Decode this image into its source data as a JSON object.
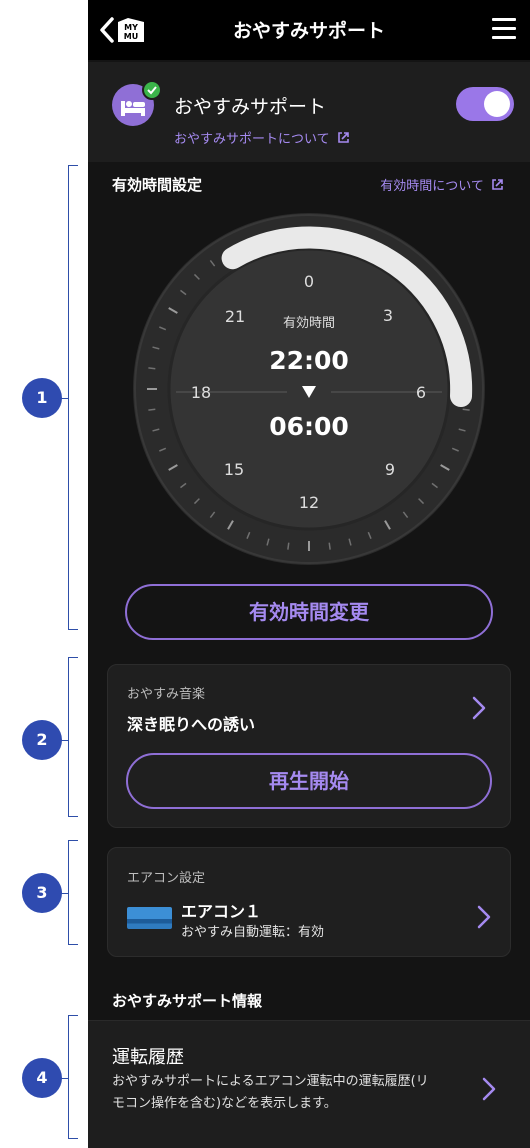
{
  "header": {
    "title": "おやすみサポート",
    "logo_text_top": "MY",
    "logo_text_bottom": "MU"
  },
  "support": {
    "title": "おやすみサポート",
    "link": "おやすみサポートについて",
    "enabled": true
  },
  "period": {
    "title": "有効時間設定",
    "link": "有効時間について",
    "dial_label": "有効時間",
    "start": "22:00",
    "end": "06:00",
    "hours": [
      "0",
      "3",
      "6",
      "9",
      "12",
      "15",
      "18",
      "21"
    ],
    "change_button": "有効時間変更"
  },
  "music": {
    "label": "おやすみ音楽",
    "name": "深き眠りへの誘い",
    "play_button": "再生開始"
  },
  "aircon": {
    "label": "エアコン設定",
    "name": "エアコン１",
    "status": "おやすみ自動運転：有効"
  },
  "info": {
    "title": "おやすみサポート情報",
    "history_title": "運転履歴",
    "history_desc": "おやすみサポートによるエアコン運転中の運転履歴(リモコン操作を含む)などを表示します。"
  },
  "annotations": [
    "1",
    "2",
    "3",
    "4"
  ],
  "colors": {
    "accent": "#9a77e8",
    "annotation": "#2f4bb0"
  }
}
